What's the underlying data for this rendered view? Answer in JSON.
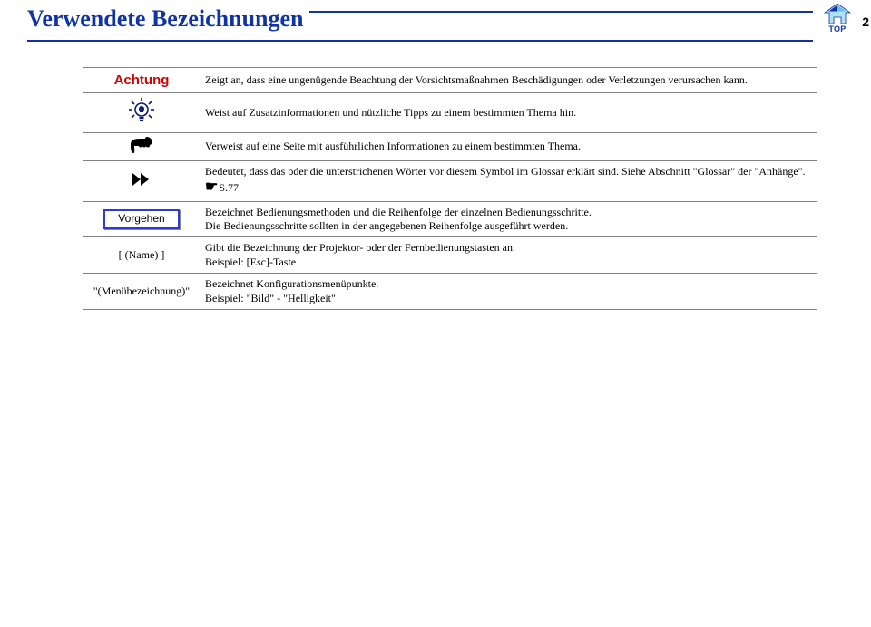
{
  "header": {
    "title": "Verwendete Bezeichnungen",
    "top_label": "TOP",
    "page_number": "2"
  },
  "rows": {
    "attention": {
      "label": "Achtung",
      "desc": "Zeigt an, dass eine ungenügende Beachtung der Vorsichtsmaßnahmen Beschädigungen oder Verletzungen verursachen kann."
    },
    "tip": {
      "desc": "Weist auf Zusatzinformationen und nützliche Tipps zu einem bestimmten Thema hin."
    },
    "reference": {
      "desc": "Verweist auf eine Seite mit ausführlichen Informationen zu einem bestimmten Thema."
    },
    "glossary": {
      "desc_pre": "Bedeutet, dass das oder die unterstrichenen Wörter vor diesem Symbol im Glossar erklärt sind. Siehe Abschnitt \"Glossar\" der \"Anhänge\". ",
      "page_ref": "S.77"
    },
    "procedure": {
      "label": "Vorgehen",
      "desc": "Bezeichnet Bedienungsmethoden und die Reihenfolge der einzelnen Bedienungsschritte.\nDie Bedienungsschritte sollten in der angegebenen Reihenfolge ausgeführt werden."
    },
    "name": {
      "label": "[ (Name) ]",
      "desc": "Gibt die Bezeichnung der Projektor- oder der Fernbedienungstasten an.\nBeispiel: [Esc]-Taste"
    },
    "menu": {
      "label": "\"(Menübezeichnung)\"",
      "desc": "Bezeichnet Konfigurationsmenüpunkte.\nBeispiel: \"Bild\" - \"Helligkeit\""
    }
  }
}
